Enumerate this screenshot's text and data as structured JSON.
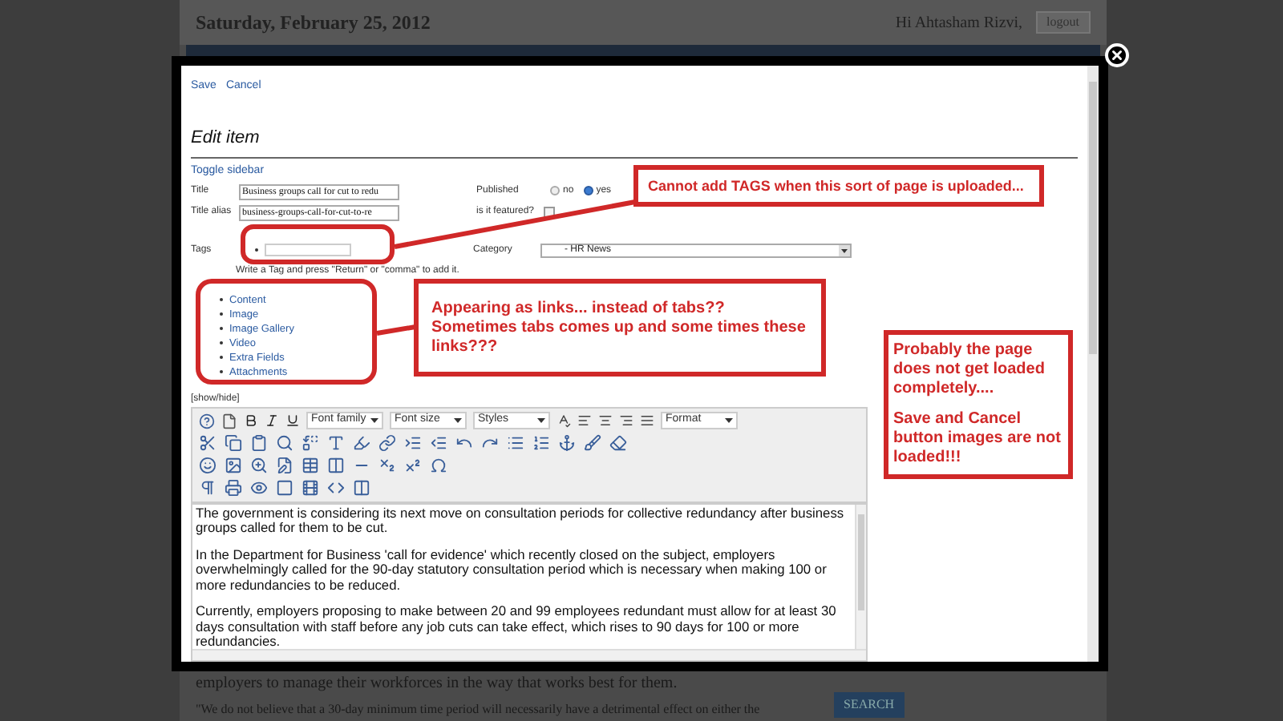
{
  "background_page": {
    "date": "Saturday, February 25, 2012",
    "greeting": "Hi Ahtasham Rizvi,",
    "logout_button": "logout",
    "body_lines": [
      "employers to manage their workforces in the way that works best for them.",
      "\"We do not believe that a 30-day minimum time period will necessarily have a detrimental effect on either the"
    ],
    "search_button": "SEARCH"
  },
  "modal": {
    "actions": [
      "Save",
      "Cancel"
    ],
    "heading": "Edit item",
    "toggle_sidebar": "Toggle sidebar",
    "title": {
      "label": "Title",
      "value": "Business groups call for cut to redu"
    },
    "title_alias": {
      "label": "Title alias",
      "value": "business-groups-call-for-cut-to-re"
    },
    "published": {
      "label": "Published",
      "options": [
        {
          "label": "no",
          "selected": false
        },
        {
          "label": "yes",
          "selected": true
        }
      ]
    },
    "featured": {
      "label": "is it featured?",
      "checked": false
    },
    "tags": {
      "label": "Tags",
      "hint": "Write a Tag and press \"Return\" or \"comma\" to add it."
    },
    "category": {
      "label": "Category",
      "value": "- HR News"
    },
    "section_links": [
      "Content",
      "Image",
      "Image Gallery",
      "Video",
      "Extra Fields",
      "Attachments"
    ],
    "show_hide": "[show/hide]",
    "editor": {
      "dropdowns": [
        "Font family",
        "Font size",
        "Styles",
        "Format"
      ],
      "paragraphs": [
        "The government is considering its next move on consultation periods for collective redundancy after business groups called for them to be cut.",
        "In the Department for Business 'call for evidence' which recently closed on the subject, employers overwhelmingly called for the 90-day statutory consultation period which is necessary when making 100 or more redundancies to be reduced.",
        "Currently, employers proposing to make between 20 and 99 employees redundant must allow for at least 30 days consultation with staff before any job cuts can take effect, which rises to 90 days for 100 or more redundancies."
      ]
    }
  },
  "annotations": [
    {
      "kind": "tags",
      "paragraphs": [
        "Cannot add TAGS when this sort of page is uploaded..."
      ]
    },
    {
      "kind": "links",
      "paragraphs": [
        "Appearing as links... instead of tabs?? Sometimes tabs comes up and some times these links???"
      ]
    },
    {
      "kind": "loading",
      "paragraphs": [
        "Probably the page does not get loaded completely....",
        "Save and Cancel button images are not loaded!!!"
      ]
    }
  ]
}
